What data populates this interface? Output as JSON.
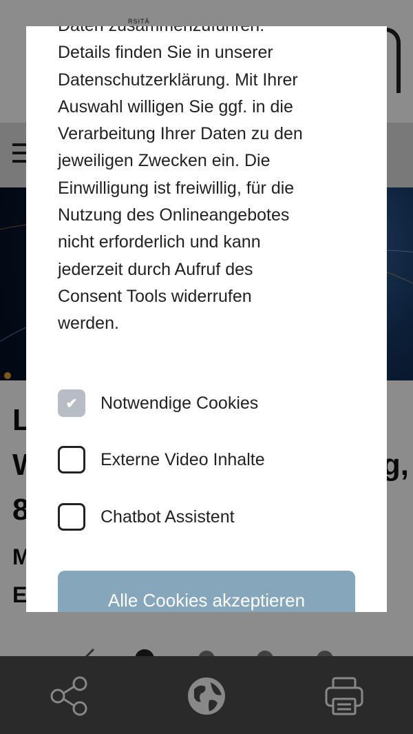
{
  "page": {
    "seal_text": "RSITÄ",
    "headline_line1_left": "L",
    "headline_line2_left": "W",
    "headline_line2_right": "g,",
    "headline_line3_left": "8",
    "sub_line1_left": "M",
    "sub_line2_left": "E"
  },
  "modal": {
    "lines": [
      "Daten zusammenzuführen.",
      "Details finden Sie in unserer",
      "Datenschutzerklärung. Mit Ihrer",
      "Auswahl willigen Sie ggf. in die",
      "Verarbeitung Ihrer Daten zu den",
      "jeweiligen Zwecken ein. Die",
      "Einwilligung ist freiwillig, für die",
      "Nutzung des Onlineangebotes",
      "nicht erforderlich und kann",
      "jederzeit durch Aufruf des",
      "Consent Tools widerrufen",
      "werden."
    ],
    "options": [
      {
        "label": "Notwendige Cookies",
        "checked": true
      },
      {
        "label": "Externe Video Inhalte",
        "checked": false
      },
      {
        "label": "Chatbot Assistent",
        "checked": false
      }
    ],
    "accept_all_label": "Alle Cookies akzeptieren",
    "accent_color": "#86a6bc"
  },
  "bottom_bar": {
    "icons": [
      "share-icon",
      "globe-icon",
      "print-icon"
    ]
  }
}
